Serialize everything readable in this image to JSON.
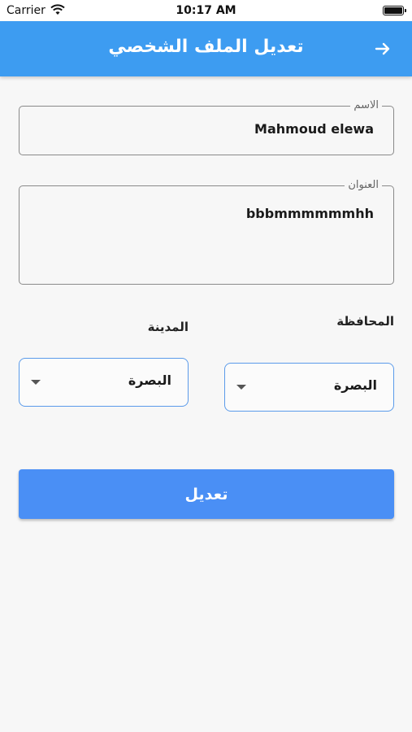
{
  "status_bar": {
    "carrier": "Carrier",
    "time": "10:17 AM"
  },
  "app_bar": {
    "title": "تعديل الملف الشخصي",
    "back_icon": "arrow-right-icon"
  },
  "form": {
    "name_label": "الاسم",
    "name_value": "Mahmoud elewa",
    "address_label": "العنوان",
    "address_value": "bbbmmmmmmhh",
    "governorate_label": "المحافظة",
    "governorate_value": "البصرة",
    "city_label": "المدينة",
    "city_value": "البصرة",
    "submit_label": "تعديل"
  },
  "colors": {
    "app_bar": "#3d9cf1",
    "button": "#4a8ff5",
    "dropdown_border": "#5b9bea"
  }
}
